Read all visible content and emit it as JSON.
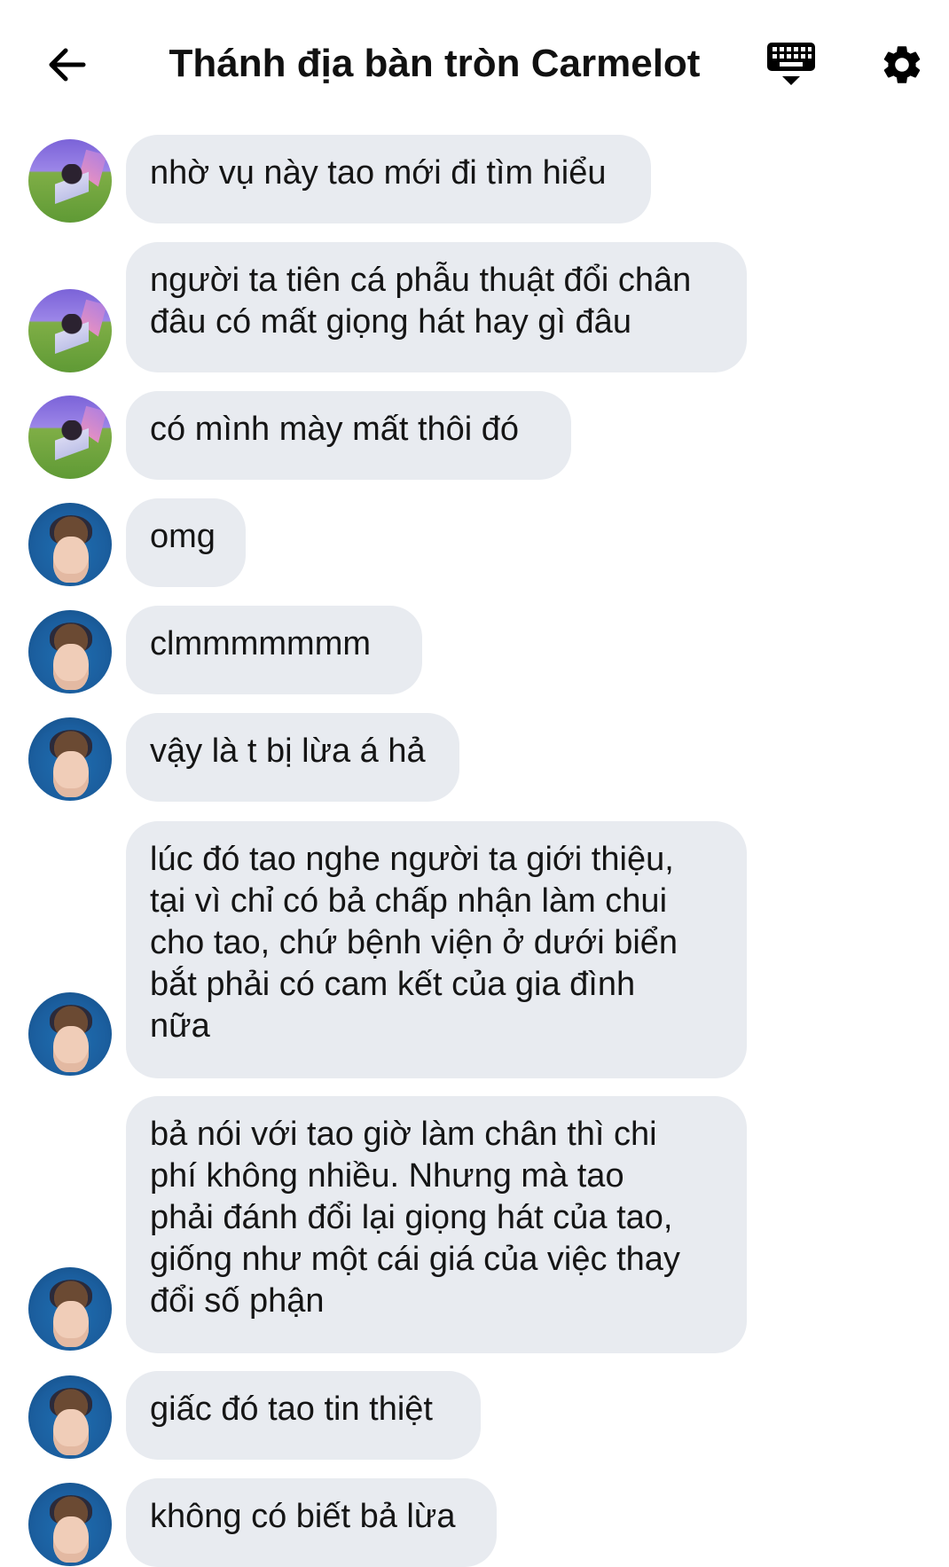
{
  "header": {
    "title": "Thánh địa bàn tròn Carmelot",
    "back_icon": "arrow-left-icon",
    "keyboard_icon": "keyboard-icon",
    "settings_icon": "gear-icon"
  },
  "colors": {
    "bubble_bg": "#e8ebf0",
    "text": "#151515",
    "background": "#ffffff"
  },
  "messages": [
    {
      "sender": "user-1",
      "text": "nhờ vụ này tao mới đi tìm hiểu"
    },
    {
      "sender": "user-1",
      "text": "người ta tiên cá phẫu thuật đổi chân\nđâu có mất giọng hát hay gì đâu"
    },
    {
      "sender": "user-1",
      "text": "có mình mày mất thôi đó"
    },
    {
      "sender": "user-2",
      "text": "omg"
    },
    {
      "sender": "user-2",
      "text": "clmmmmmmm"
    },
    {
      "sender": "user-2",
      "text": "vậy là t bị lừa á hả"
    },
    {
      "sender": "user-2",
      "text": "lúc đó tao nghe người ta giới thiệu,\ntại vì chỉ có bả chấp nhận làm chui\ncho tao, chứ bệnh viện ở dưới biển\nbắt phải có cam kết của gia đình\nnữa"
    },
    {
      "sender": "user-2",
      "text": "bả nói với tao giờ làm chân thì  chi\nphí không nhiều. Nhưng mà tao\nphải đánh đổi lại giọng hát của tao,\ngiống như một cái giá của việc thay\nđổi số phận"
    },
    {
      "sender": "user-2",
      "text": "giấc đó tao tin thiệt"
    },
    {
      "sender": "user-2",
      "text": "không có biết bả lừa"
    }
  ]
}
